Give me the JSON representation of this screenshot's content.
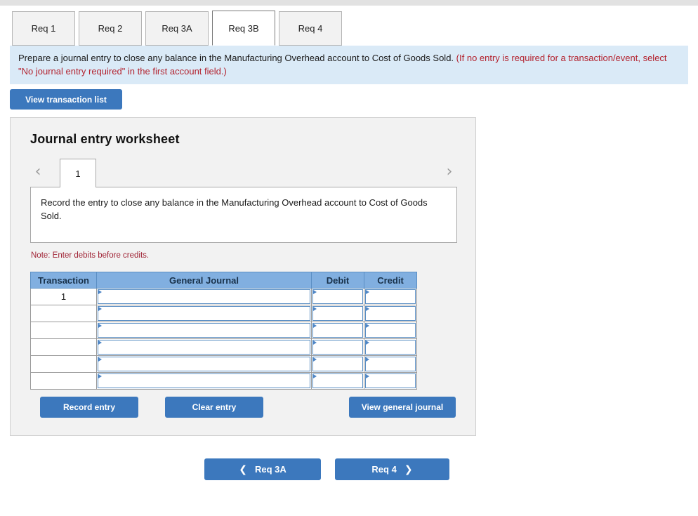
{
  "colors": {
    "button_blue": "#3c78bd",
    "table_header_blue": "#81afe0",
    "banner_blue": "#daeaf7",
    "note_red": "#a02335",
    "instruction_red": "#b3232f",
    "panel_gray": "#f2f2f2"
  },
  "tabs": [
    {
      "label": "Req 1",
      "active": false
    },
    {
      "label": "Req 2",
      "active": false
    },
    {
      "label": "Req 3A",
      "active": false
    },
    {
      "label": "Req 3B",
      "active": true
    },
    {
      "label": "Req 4",
      "active": false
    }
  ],
  "instruction": {
    "main": "Prepare a journal entry to close any balance in the Manufacturing Overhead account to Cost of Goods Sold.",
    "parenthetical": "(If no entry is required for a transaction/event, select \"No journal entry required\" in the first account field.)"
  },
  "toolbar": {
    "view_transaction_list_label": "View transaction list"
  },
  "worksheet": {
    "title": "Journal entry worksheet",
    "pager": {
      "prev_icon": "chevron-left-icon",
      "next_icon": "chevron-right-icon",
      "current_page": "1"
    },
    "description": "Record the entry to close any balance in the Manufacturing Overhead account to Cost of Goods Sold.",
    "note": "Note: Enter debits before credits.",
    "table": {
      "headers": [
        "Transaction",
        "General Journal",
        "Debit",
        "Credit"
      ],
      "rows": [
        {
          "transaction": "1",
          "general_journal": "",
          "debit": "",
          "credit": ""
        },
        {
          "transaction": "",
          "general_journal": "",
          "debit": "",
          "credit": ""
        },
        {
          "transaction": "",
          "general_journal": "",
          "debit": "",
          "credit": ""
        },
        {
          "transaction": "",
          "general_journal": "",
          "debit": "",
          "credit": ""
        },
        {
          "transaction": "",
          "general_journal": "",
          "debit": "",
          "credit": ""
        },
        {
          "transaction": "",
          "general_journal": "",
          "debit": "",
          "credit": ""
        }
      ]
    },
    "actions": {
      "record_entry_label": "Record entry",
      "clear_entry_label": "Clear entry",
      "view_general_journal_label": "View general journal"
    }
  },
  "bottom_nav": {
    "prev_label": "Req 3A",
    "next_label": "Req 4",
    "prev_icon": "chevron-left-icon",
    "next_icon": "chevron-right-icon"
  }
}
